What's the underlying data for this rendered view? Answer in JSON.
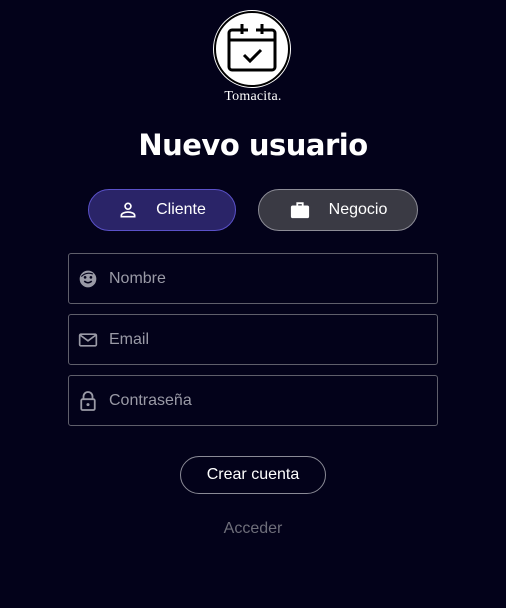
{
  "brand": {
    "name": "Tomacita.",
    "logo_icon": "calendar-check-icon"
  },
  "heading": {
    "title": "Nuevo usuario"
  },
  "account_type": {
    "options": [
      {
        "label": "Cliente",
        "icon": "person-icon",
        "selected": true
      },
      {
        "label": "Negocio",
        "icon": "briefcase-icon",
        "selected": false
      }
    ]
  },
  "form": {
    "name": {
      "placeholder": "Nombre",
      "value": "",
      "icon": "face-icon"
    },
    "email": {
      "placeholder": "Email",
      "value": "",
      "icon": "mail-icon"
    },
    "password": {
      "placeholder": "Contraseña",
      "value": "",
      "icon": "lock-icon"
    }
  },
  "actions": {
    "create_label": "Crear cuenta",
    "login_label": "Acceder"
  },
  "colors": {
    "background": "#03021a",
    "selected_toggle": "#2a2468",
    "unselected_toggle": "#3a3a44",
    "muted_text": "#6e6e7a"
  }
}
